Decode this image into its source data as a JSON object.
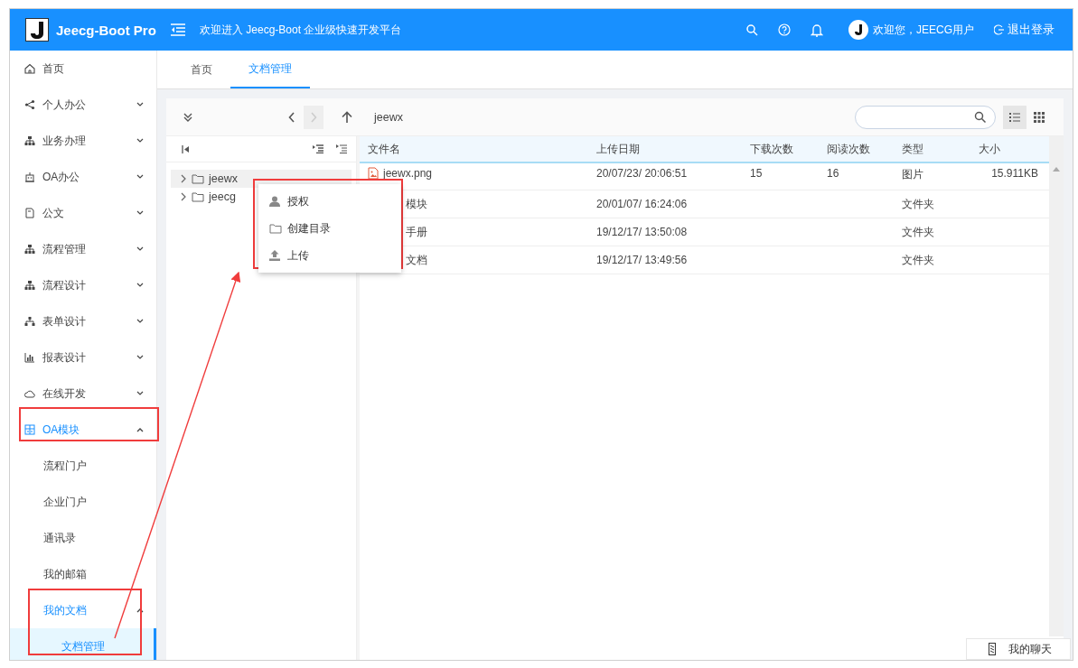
{
  "header": {
    "logo_text": "Jeecg-Boot Pro",
    "welcome": "欢迎进入 Jeecg-Boot 企业级快速开发平台",
    "user_greeting": "欢迎您，JEECG用户",
    "logout": "退出登录"
  },
  "sidebar": {
    "items": [
      {
        "label": "首页",
        "selected": false
      },
      {
        "label": "个人办公",
        "selected": false,
        "expanded": false
      },
      {
        "label": "业务办理",
        "selected": false,
        "expanded": false
      },
      {
        "label": "OA办公",
        "selected": false,
        "expanded": false
      },
      {
        "label": "公文",
        "selected": false,
        "expanded": false
      },
      {
        "label": "流程管理",
        "selected": false,
        "expanded": false
      },
      {
        "label": "流程设计",
        "selected": false,
        "expanded": false
      },
      {
        "label": "表单设计",
        "selected": false,
        "expanded": false
      },
      {
        "label": "报表设计",
        "selected": false,
        "expanded": false
      },
      {
        "label": "在线开发",
        "selected": false,
        "expanded": false
      },
      {
        "label": "OA模块",
        "selected": false,
        "expanded": true,
        "children": [
          {
            "label": "流程门户",
            "selected": false
          },
          {
            "label": "企业门户",
            "selected": false
          },
          {
            "label": "通讯录",
            "selected": false
          },
          {
            "label": "我的邮箱",
            "selected": false
          },
          {
            "label": "我的文档",
            "selected": false,
            "expanded": true,
            "children": [
              {
                "label": "文档管理",
                "selected": true
              }
            ]
          }
        ]
      }
    ]
  },
  "tabs": [
    {
      "label": "首页",
      "selected": false
    },
    {
      "label": "文档管理",
      "selected": true
    }
  ],
  "file_manager": {
    "toolbar": {
      "back": {
        "disabled": false
      },
      "forward": {
        "disabled": true
      },
      "path": "jeewx",
      "views": [
        {
          "kind": "list",
          "selected": true
        },
        {
          "kind": "grid",
          "selected": false
        }
      ]
    },
    "tree": {
      "nodes": [
        {
          "label": "jeewx",
          "selected": true,
          "expanded": false
        },
        {
          "label": "jeecg",
          "selected": false,
          "expanded": false
        }
      ]
    },
    "table": {
      "columns": [
        "文件名",
        "上传日期",
        "下载次数",
        "阅读次数",
        "类型",
        "大小"
      ],
      "rows": [
        {
          "kind": "image",
          "name": "jeewx.png",
          "date": "20/07/23/ 20:06:51",
          "downloads": "15",
          "reads": "16",
          "type": "图片",
          "size": "15.911KB"
        },
        {
          "kind": "folder",
          "name": "模块",
          "date": "20/01/07/ 16:24:06",
          "type": "文件夹"
        },
        {
          "kind": "folder",
          "name": "手册",
          "date": "19/12/17/ 13:50:08",
          "type": "文件夹"
        },
        {
          "kind": "folder",
          "name": "文档",
          "date": "19/12/17/ 13:49:56",
          "type": "文件夹"
        }
      ]
    },
    "context_menu": {
      "items": [
        {
          "label": "授权"
        },
        {
          "label": "创建目录"
        },
        {
          "label": "上传"
        }
      ]
    }
  },
  "chat_tab": {
    "label": "我的聊天"
  }
}
